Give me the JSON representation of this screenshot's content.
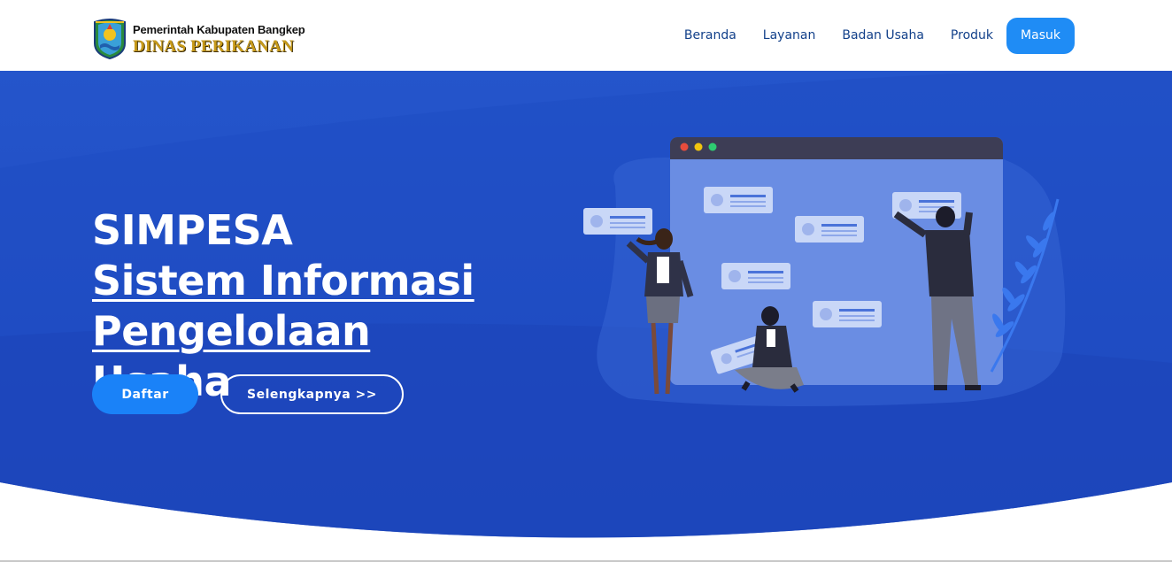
{
  "brand": {
    "line1": "Pemerintah Kabupaten Bangkep",
    "line2": "DINAS PERIKANAN",
    "logo_icon": "regency-emblem-icon"
  },
  "nav": {
    "items": [
      {
        "label": "Beranda"
      },
      {
        "label": "Layanan"
      },
      {
        "label": "Badan Usaha"
      },
      {
        "label": "Produk"
      }
    ],
    "login_label": "Masuk"
  },
  "hero": {
    "title": "SIMPESA",
    "subtitle_line1": "Sistem Informasi",
    "subtitle_line2": "Pengelolaan",
    "subtitle_line3": "Usaha",
    "primary_button": "Daftar",
    "secondary_button": "Selengkapnya >>",
    "illustration_icon": "people-browser-cards-illustration"
  },
  "colors": {
    "hero_blue": "#1f4fc4",
    "hero_dark": "#1a3fae",
    "accent": "#1f8cf5",
    "nav_text": "#12408a",
    "brand_gold": "#c79a1a"
  }
}
